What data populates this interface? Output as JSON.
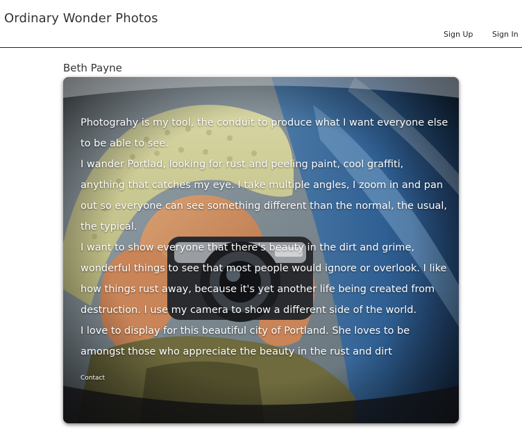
{
  "header": {
    "site_title": "Ordinary Wonder Photos",
    "nav": {
      "sign_up": "Sign Up",
      "sign_in": "Sign In"
    }
  },
  "profile": {
    "name": "Beth Payne",
    "bio_paragraphs": [
      "Photograhy is my tool, the conduit to produce what I want everyone else to be able to see.",
      "I wander Portlad, looking for rust and peeling paint, cool graffiti, anything that catches my eye. I take multiple angles, I zoom in and pan out so everyone can see something different than the normal, the usual, the typical.",
      "I want to show everyone that there's beauty in the dirt and grime, wonderful things to see that most people would ignore or overlook. I like how things rust away, because it's yet another life being created from destruction. I use my camera to show a different side of the world.",
      "I love to display for this beautiful city of Portland. She loves to be amongst those who appreciate the beauty in the rust and dirt"
    ],
    "contact_label": "Contact"
  }
}
